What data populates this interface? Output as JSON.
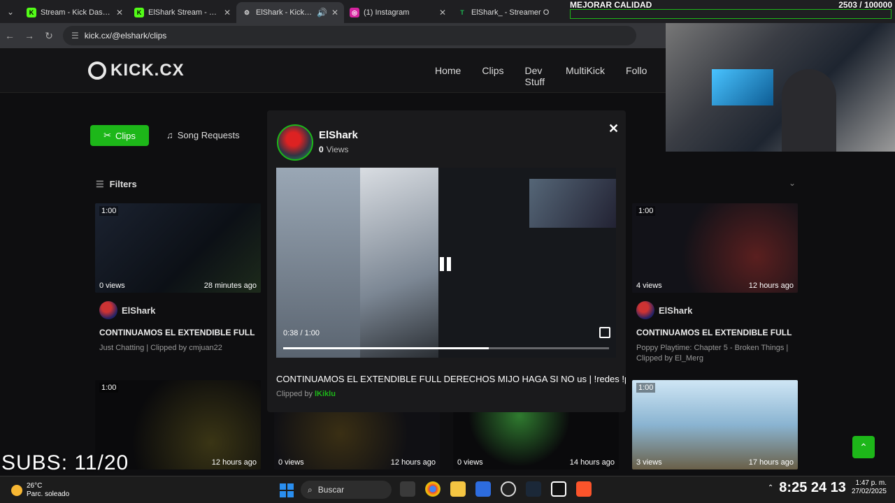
{
  "browser": {
    "tabs": [
      {
        "title": "Stream - Kick Dashboard",
        "color": "#53fc18",
        "glyph": "K"
      },
      {
        "title": "ElShark Stream - Watch",
        "color": "#53fc18",
        "glyph": "K"
      },
      {
        "title": "ElShark - Kick.CX",
        "color": "#888",
        "glyph": "⚙"
      },
      {
        "title": "(1) Instagram",
        "color": "#d6249f",
        "glyph": "◎"
      },
      {
        "title": "ElShark_ - Streamer O",
        "color": "#1db954",
        "glyph": "T"
      }
    ],
    "url": "kick.cx/@elshark/clips"
  },
  "site": {
    "logo_text": "KICK.CX",
    "nav": [
      "Home",
      "Clips",
      "Dev Stuff",
      "MultiKick",
      "Follo"
    ],
    "tabs": {
      "clips": "Clips",
      "song_requests": "Song Requests"
    },
    "filters": "Filters"
  },
  "cards": [
    {
      "duration": "1:00",
      "views": "0 views",
      "age": "28 minutes ago",
      "streamer": "ElShark",
      "title": "CONTINUAMOS EL EXTENDIBLE FULL DE",
      "meta": "Just Chatting | Clipped by cmjuan22"
    },
    {
      "duration": "1:00",
      "views": "4 views",
      "age": "12 hours ago",
      "streamer": "ElShark",
      "title": "CONTINUAMOS EL EXTENDIBLE FULL DE",
      "meta": "Poppy Playtime: Chapter 5 - Broken Things | Clipped by El_Merg"
    },
    {
      "duration": "1:00",
      "views": "",
      "age": "12 hours ago"
    },
    {
      "duration": "",
      "views": "0 views",
      "age": "12 hours ago"
    },
    {
      "duration": "",
      "views": "0 views",
      "age": "14 hours ago"
    },
    {
      "duration": "1:00",
      "views": "3 views",
      "age": "17 hours ago"
    }
  ],
  "modal": {
    "streamer": "ElShark",
    "views_count": "0",
    "views_label": "Views",
    "time": "0:38 / 1:00",
    "progress": 0.63,
    "title": "CONTINUAMOS EL EXTENDIBLE FULL DERECHOS MIJO HAGA SI NO us | !redes !p",
    "clipped_by_label": "Clipped by",
    "clipper": "lKiklu"
  },
  "overlay": {
    "title": "MEJORAR CALIDAD",
    "goal": "2503 / 100000",
    "subs": "SUBS: 11/20"
  },
  "taskbar": {
    "temp": "26°C",
    "weather": "Parc. soleado",
    "search": "Buscar",
    "clock_big": "8:25 24 13",
    "time": "1:47 p. m.",
    "date": "27/02/2025"
  }
}
